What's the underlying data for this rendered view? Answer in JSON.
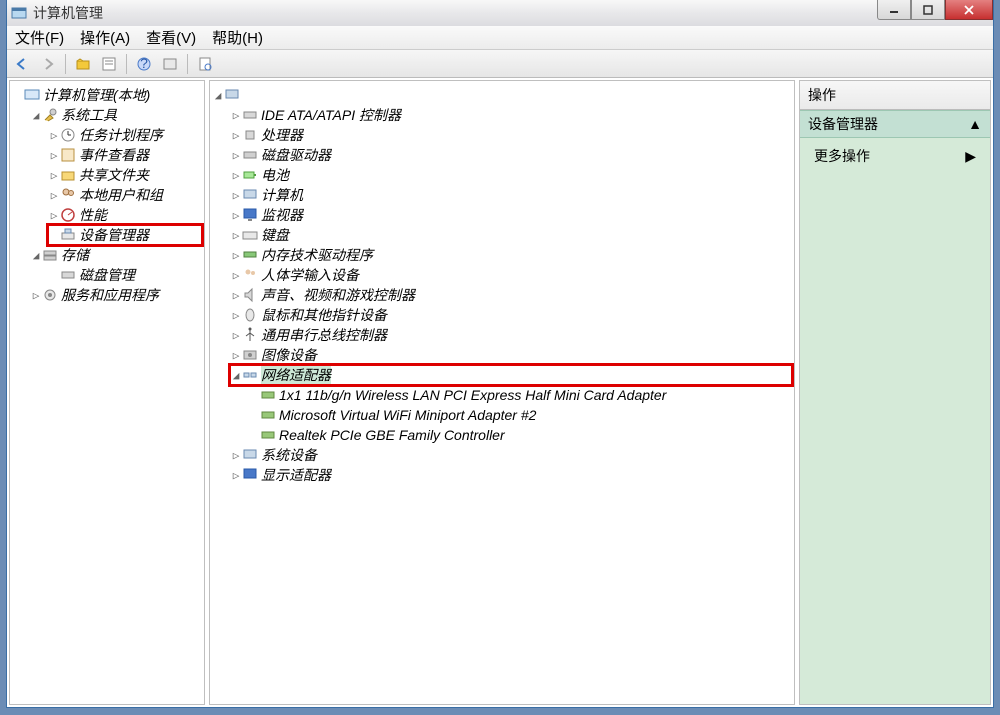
{
  "window": {
    "title": "计算机管理"
  },
  "menubar": {
    "file": "文件(F)",
    "action": "操作(A)",
    "view": "查看(V)",
    "help": "帮助(H)"
  },
  "left_tree": {
    "root": "计算机管理(本地)",
    "system_tools": "系统工具",
    "task_scheduler": "任务计划程序",
    "event_viewer": "事件查看器",
    "shared_folders": "共享文件夹",
    "local_users": "本地用户和组",
    "performance": "性能",
    "device_manager": "设备管理器",
    "storage": "存储",
    "disk_mgmt": "磁盘管理",
    "services_apps": "服务和应用程序"
  },
  "center": {
    "ide": "IDE ATA/ATAPI 控制器",
    "cpu": "处理器",
    "disk_drives": "磁盘驱动器",
    "battery": "电池",
    "computer": "计算机",
    "monitor": "监视器",
    "keyboard": "键盘",
    "memory": "内存技术驱动程序",
    "hid": "人体学输入设备",
    "sound": "声音、视频和游戏控制器",
    "mouse": "鼠标和其他指针设备",
    "usb": "通用串行总线控制器",
    "imaging": "图像设备",
    "network": "网络适配器",
    "net1": "1x1 11b/g/n Wireless LAN PCI Express Half Mini Card Adapter",
    "net2": "Microsoft Virtual WiFi Miniport Adapter #2",
    "net3": "Realtek PCIe GBE Family Controller",
    "system_devices": "系统设备",
    "display": "显示适配器"
  },
  "actions": {
    "header": "操作",
    "subheader": "设备管理器",
    "more": "更多操作"
  }
}
